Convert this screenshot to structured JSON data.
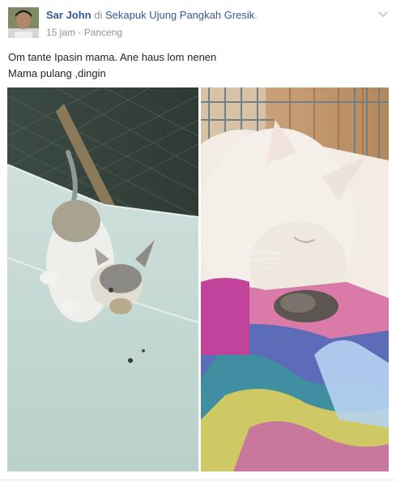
{
  "post": {
    "author": "Sar John",
    "at_word": "di",
    "place": "Sekapuk Ujung Pangkah Gresik",
    "period": ".",
    "time": "15 jam",
    "separator": "·",
    "location": "Panceng",
    "message_lines": [
      "Om tante Ipasin mama. Ane haus lom nenen",
      "Mama pulang ,dingin"
    ]
  },
  "colors": {
    "link": "#365899",
    "meta": "#90949c",
    "text": "#1d2129"
  },
  "icons": {
    "options": "chevron-down-icon"
  }
}
